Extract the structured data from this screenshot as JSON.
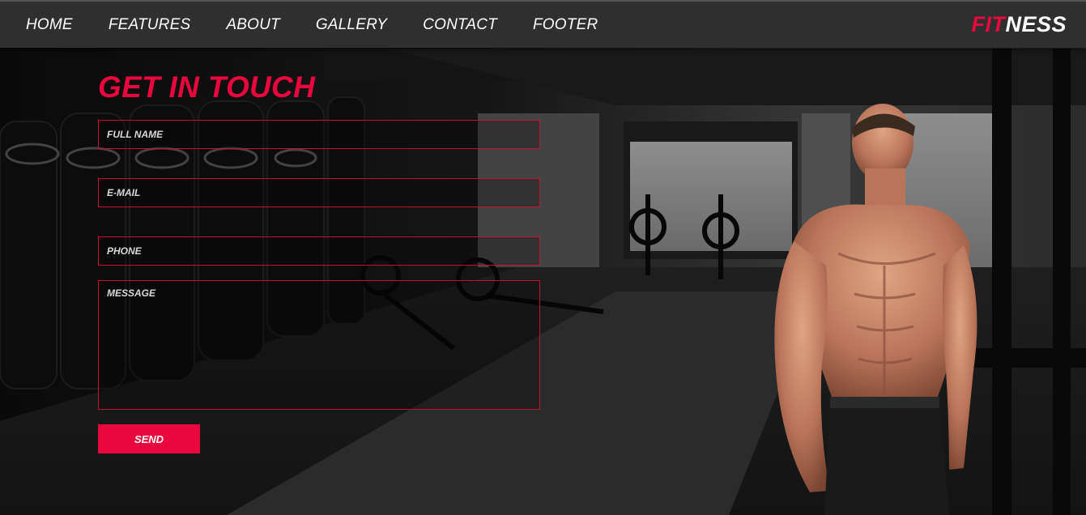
{
  "nav": {
    "links": [
      "HOME",
      "FEATURES",
      "ABOUT",
      "GALLERY",
      "CONTACT",
      "FOOTER"
    ]
  },
  "brand": {
    "part1": "FIT",
    "part2": "NESS"
  },
  "contact": {
    "title": "GET IN TOUCH",
    "full_name_placeholder": "FULL NAME",
    "email_placeholder": "E-MAIL",
    "phone_placeholder": "PHONE",
    "message_placeholder": "MESSAGE",
    "send_label": "SEND"
  },
  "colors": {
    "accent": "#e8083e",
    "nav_bg": "#2f2f2f",
    "text": "#ffffff"
  }
}
